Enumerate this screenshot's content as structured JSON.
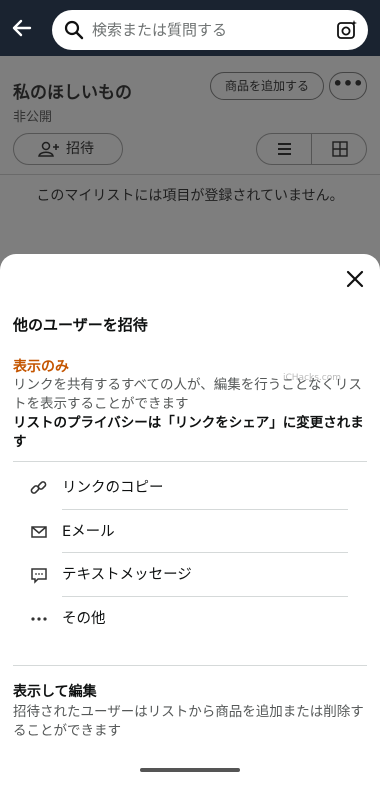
{
  "header": {
    "search_placeholder": "検索または質問する"
  },
  "background": {
    "list_title": "私のほしいもの",
    "privacy": "非公開",
    "add_item_label": "商品を追加する",
    "more_label": "•••",
    "invite_label": "招待",
    "empty_message": "このマイリストには項目が登録されていません。"
  },
  "sheet": {
    "title": "他のユーザーを招待",
    "view_only": {
      "title": "表示のみ",
      "description": "リンクを共有するすべての人が、編集を行うことなくリストを表示することができます",
      "note": "リストのプライバシーは「リンクをシェア」に変更されます",
      "watermark": "iCHacks.com"
    },
    "share_options": [
      {
        "label": "リンクのコピー",
        "icon": "link-icon"
      },
      {
        "label": "Eメール",
        "icon": "mail-icon"
      },
      {
        "label": "テキストメッセージ",
        "icon": "message-icon"
      },
      {
        "label": "その他",
        "icon": "more-dots-icon"
      }
    ],
    "view_and_edit": {
      "title": "表示して編集",
      "description": "招待されたユーザーはリストから商品を追加または削除することができます"
    }
  },
  "colors": {
    "accent_orange": "#c45500",
    "topbar": "#1a2330"
  }
}
